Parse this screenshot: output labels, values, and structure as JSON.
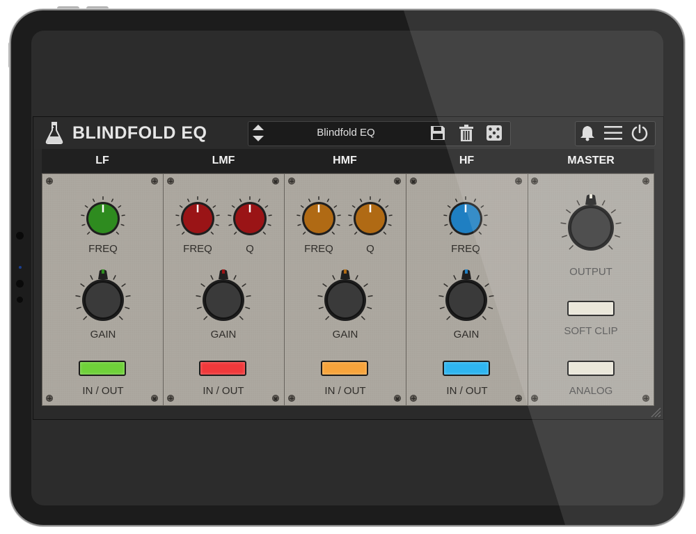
{
  "plugin": {
    "title": "BLINDFOLD EQ",
    "preset_name": "Blindfold EQ"
  },
  "bands": [
    {
      "id": "lf",
      "title": "LF",
      "color": "#2e8b1f",
      "knobs": [
        "FREQ"
      ],
      "gain_label": "GAIN",
      "switch_label": "IN / OUT",
      "switch_color": "#6fd13a"
    },
    {
      "id": "lmf",
      "title": "LMF",
      "color": "#9a1416",
      "knobs": [
        "FREQ",
        "Q"
      ],
      "gain_label": "GAIN",
      "switch_label": "IN / OUT",
      "switch_color": "#f0393b"
    },
    {
      "id": "hmf",
      "title": "HMF",
      "color": "#b06a14",
      "knobs": [
        "FREQ",
        "Q"
      ],
      "gain_label": "GAIN",
      "switch_label": "IN / OUT",
      "switch_color": "#f7a43c"
    },
    {
      "id": "hf",
      "title": "HF",
      "color": "#1f7fc2",
      "knobs": [
        "FREQ"
      ],
      "gain_label": "GAIN",
      "switch_label": "IN / OUT",
      "switch_color": "#2fb5f0"
    }
  ],
  "master": {
    "title": "MASTER",
    "output_label": "OUTPUT",
    "soft_clip_label": "SOFT CLIP",
    "analog_label": "ANALOG",
    "switch_color": "#e8e5d6"
  },
  "icons": [
    "flask-icon",
    "up-down-arrows-icon",
    "save-icon",
    "trash-icon",
    "dice-icon",
    "bell-icon",
    "menu-icon",
    "power-icon"
  ]
}
